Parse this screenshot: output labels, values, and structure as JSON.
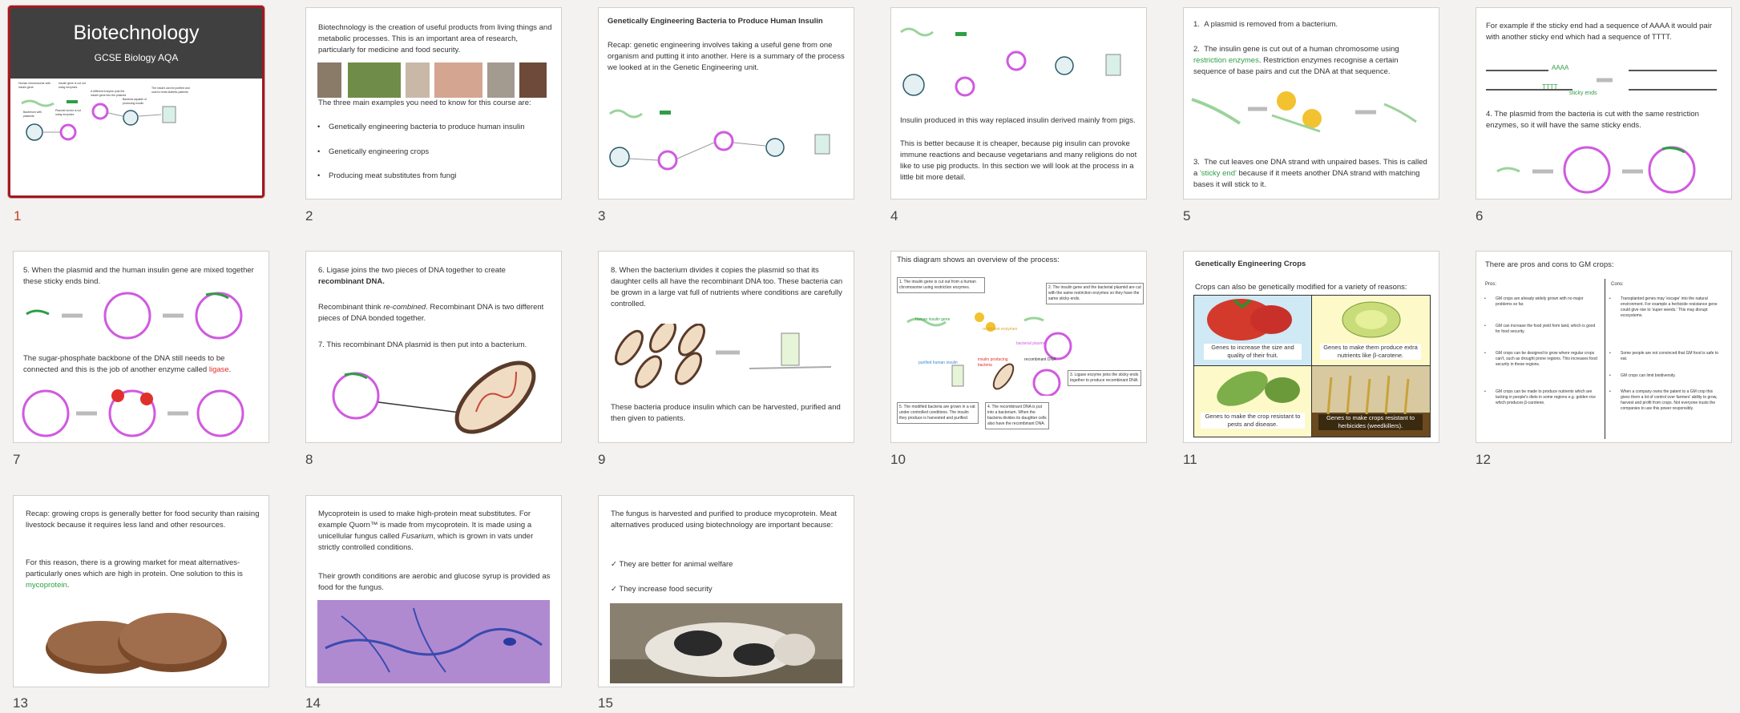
{
  "slides": [
    {
      "num": "1",
      "title": "Biotechnology",
      "subtitle": "GCSE Biology AQA",
      "labels": [
        "Human chromosome with insulin gene",
        "Insulin gene is cut out using enzymes",
        "A different enzyme puts the insulin gene into the plasmid",
        "Bacteria capable of producing insulin",
        "The insulin can be purified and used to treat diabetic patients",
        "Bacterium with plasmids",
        "Plasmid vector is cut using enzymes"
      ]
    },
    {
      "num": "2",
      "intro": "Biotechnology is the creation of useful products from living things and metabolic processes. This is an important area of research, particularly for medicine and food security.",
      "lead": "The three main examples you need to know for this course are:",
      "bullets": [
        "Genetically engineering bacteria to produce human insulin",
        "Genetically engineering crops",
        "Producing meat substitutes from fungi"
      ]
    },
    {
      "num": "3",
      "heading": "Genetically Engineering Bacteria to Produce Human Insulin",
      "text": "Recap: genetic engineering involves taking a useful gene from one organism and putting it into another. Here is a summary of the process we looked at in the Genetic Engineering unit."
    },
    {
      "num": "4",
      "p1": "Insulin produced in this way replaced insulin derived mainly from pigs.",
      "p2": "This is better because it is cheaper, because pig insulin can provoke immune reactions and because vegetarians and many religions do not like to use pig products. In this section we will look at the process in a little bit more detail."
    },
    {
      "num": "5",
      "s1": "A plasmid is removed from a bacterium.",
      "s2a": "The insulin gene is cut out of a human chromosome using ",
      "s2g": "restriction enzymes",
      "s2b": ". Restriction enzymes recognise a certain sequence of base pairs and cut the DNA at that sequence.",
      "s3a": "The cut leaves one DNA strand with unpaired bases. This is called a ",
      "s3g": "'sticky end'",
      "s3b": " because if it meets another DNA strand with matching bases it will stick to it."
    },
    {
      "num": "6",
      "p1": "For example if the sticky end had a sequence of AAAA it would pair with another sticky end which had a sequence of TTTT.",
      "dna_top": "AAAA",
      "dna_bot": "TTTT",
      "sticky": "sticky ends",
      "p2": "4. The plasmid from the bacteria is cut with the same restriction enzymes, so it will have the same sticky ends."
    },
    {
      "num": "7",
      "p1": "5. When the plasmid and the human insulin gene are mixed together these sticky ends bind.",
      "p2a": "The sugar-phosphate backbone of the DNA still needs to be connected and this is the job of another enzyme called ",
      "p2r": "ligase",
      "p2b": "."
    },
    {
      "num": "8",
      "p1a": "6. Ligase joins the two pieces of DNA together to create ",
      "p1b": "recombinant DNA.",
      "p2a": "Recombinant think ",
      "p2i": "re-combined",
      "p2b": ". Recombinant DNA is two different pieces of DNA bonded together.",
      "p3": "7. This recombinant DNA plasmid is then put into a bacterium."
    },
    {
      "num": "9",
      "p1": "8. When the bacterium divides it copies the plasmid so that its daughter cells all have the recombinant DNA too. These bacteria can be grown in a large vat full of nutrients where conditions are carefully controlled.",
      "p2": "These bacteria produce insulin which can be harvested, purified and then given to patients."
    },
    {
      "num": "10",
      "heading": "This diagram shows an overview of the process:",
      "b1": "1. The insulin gene is cut out from a human chromosome using restriction enzymes.",
      "b2": "2. The insulin gene and the bacterial plasmid are cut with the same restriction enzymes so they have the same sticky ends.",
      "b3": "3. Ligase enzyme joins the sticky ends together to produce recombinant DNA.",
      "b4": "4. The recombinant DNA is put into a bacterium. When the bacteria divides its daughter cells also have the recombinant DNA.",
      "b5": "5. The modified bacteria are grown in a vat under controlled conditions. The insulin they produce is harvested and purified.",
      "l_gene": "human insulin gene",
      "l_enz": "restriction enzymes",
      "l_plasmid": "bacterial plasmid",
      "l_purified": "purified human insulin",
      "l_prod": "insulin producing bacteria",
      "l_rec": "recombinant DNA"
    },
    {
      "num": "11",
      "heading": "Genetically Engineering Crops",
      "lead": "Crops can also be genetically modified for a variety of reasons:",
      "c1": "Genes to increase the size and quality of their fruit.",
      "c2": "Genes to make them produce extra nutrients like β-carotene.",
      "c3": "Genes to make the crop resistant to pests and disease.",
      "c4": "Genes to make crops resistant to herbicides (weedkillers)."
    },
    {
      "num": "12",
      "heading": "There are pros and cons to GM crops:",
      "pros_h": "Pros:",
      "cons_h": "Cons:",
      "pros": [
        "GM crops are already widely grown with no major problems so far.",
        "GM can increase the food yield from land, which is good for food security.",
        "GM crops can be designed to grow where regular crops can't, such as drought prone regions. This increases food security in these regions.",
        "GM crops can be made to produce nutrients which are lacking in people's diets in some regions e.g. golden rice which produces β-carotene."
      ],
      "cons": [
        "Transplanted genes may 'escape' into the natural environment. For example a herbicide resistance gene could give rise to 'super weeds.' This may disrupt ecosystems.",
        "Some people are not convinced that GM food is safe to eat.",
        "GM crops can limit biodiversity.",
        "When a company owns the patent to a GM crop this gives them a lot of control over farmers' ability to grow, harvest and profit from crops. Not everyone trusts the companies to use this power responsibly."
      ]
    },
    {
      "num": "13",
      "p1": "Recap: growing crops is generally better for food security than raising livestock because it requires less land and other resources.",
      "p2a": "For this reason, there is a growing market for meat alternatives-particularly ones which are high in protein. One solution to this is ",
      "p2g": "mycoprotein",
      "p2b": "."
    },
    {
      "num": "14",
      "p1a": "Mycoprotein is used to make high-protein meat substitutes. For example Quorn™ is made from mycoprotein. It is made using a unicellular fungus called ",
      "p1i": "Fusarium",
      "p1b": ", which is grown in vats under strictly controlled conditions.",
      "p2": "Their growth conditions are aerobic and glucose syrup is provided as food for the fungus."
    },
    {
      "num": "15",
      "p1": "The fungus is harvested and purified to produce mycoprotein. Meat alternatives produced using biotechnology are important because:",
      "t1": "✓ They are better for animal welfare",
      "t2": "✓ They increase food security"
    }
  ],
  "colors": {
    "accent": "#9e1a22",
    "green": "#2e9e44",
    "red": "#e0302a",
    "plasmid": "#d05ae0"
  }
}
